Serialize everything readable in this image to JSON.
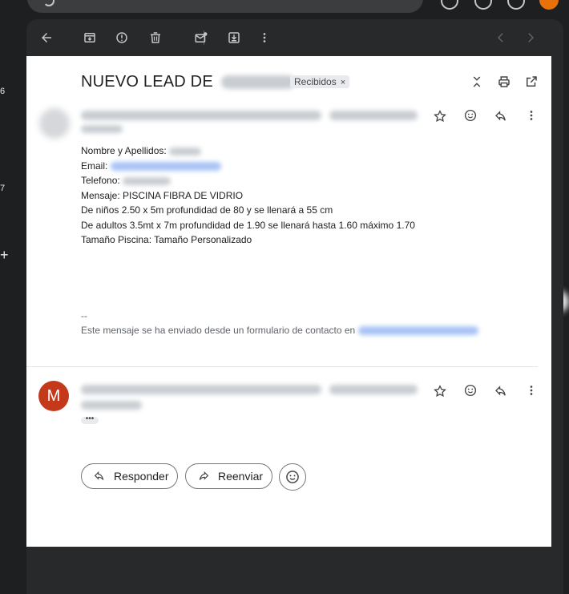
{
  "left_rail": {
    "counts": [
      "6",
      "7"
    ],
    "plus": "+"
  },
  "toolbar": {
    "icons": [
      "back-arrow-icon",
      "archive-icon",
      "report-spam-icon",
      "delete-icon",
      "mark-unread-icon",
      "move-to-icon",
      "more-icon",
      "newer-icon",
      "older-icon"
    ]
  },
  "email": {
    "subject": "NUEVO LEAD DE",
    "label_chip": "Recibidos",
    "label_chip_close": "×",
    "fields": {
      "name_label": "Nombre y Apellidos:",
      "email_label": "Email:",
      "phone_label": "Telefono:",
      "message": "Mensaje: PISCINA FIBRA DE VIDRIO",
      "line_ninos": "De niños 2.50 x 5m profundidad de 80 y se llenará a 55 cm",
      "line_adultos": "De adultos 3.5mt x 7m profundidad de 1.90 se llenará hasta 1.60 máximo 1.70",
      "size": "Tamaño Piscina: Tamaño Personalizado"
    },
    "signature_sep": "--",
    "signature": "Este mensaje se ha enviado desde un formulario de contacto en"
  },
  "second_message": {
    "avatar_letter": "M",
    "expand_dots": "•••"
  },
  "actions": {
    "reply": "Responder",
    "forward": "Reenviar"
  }
}
